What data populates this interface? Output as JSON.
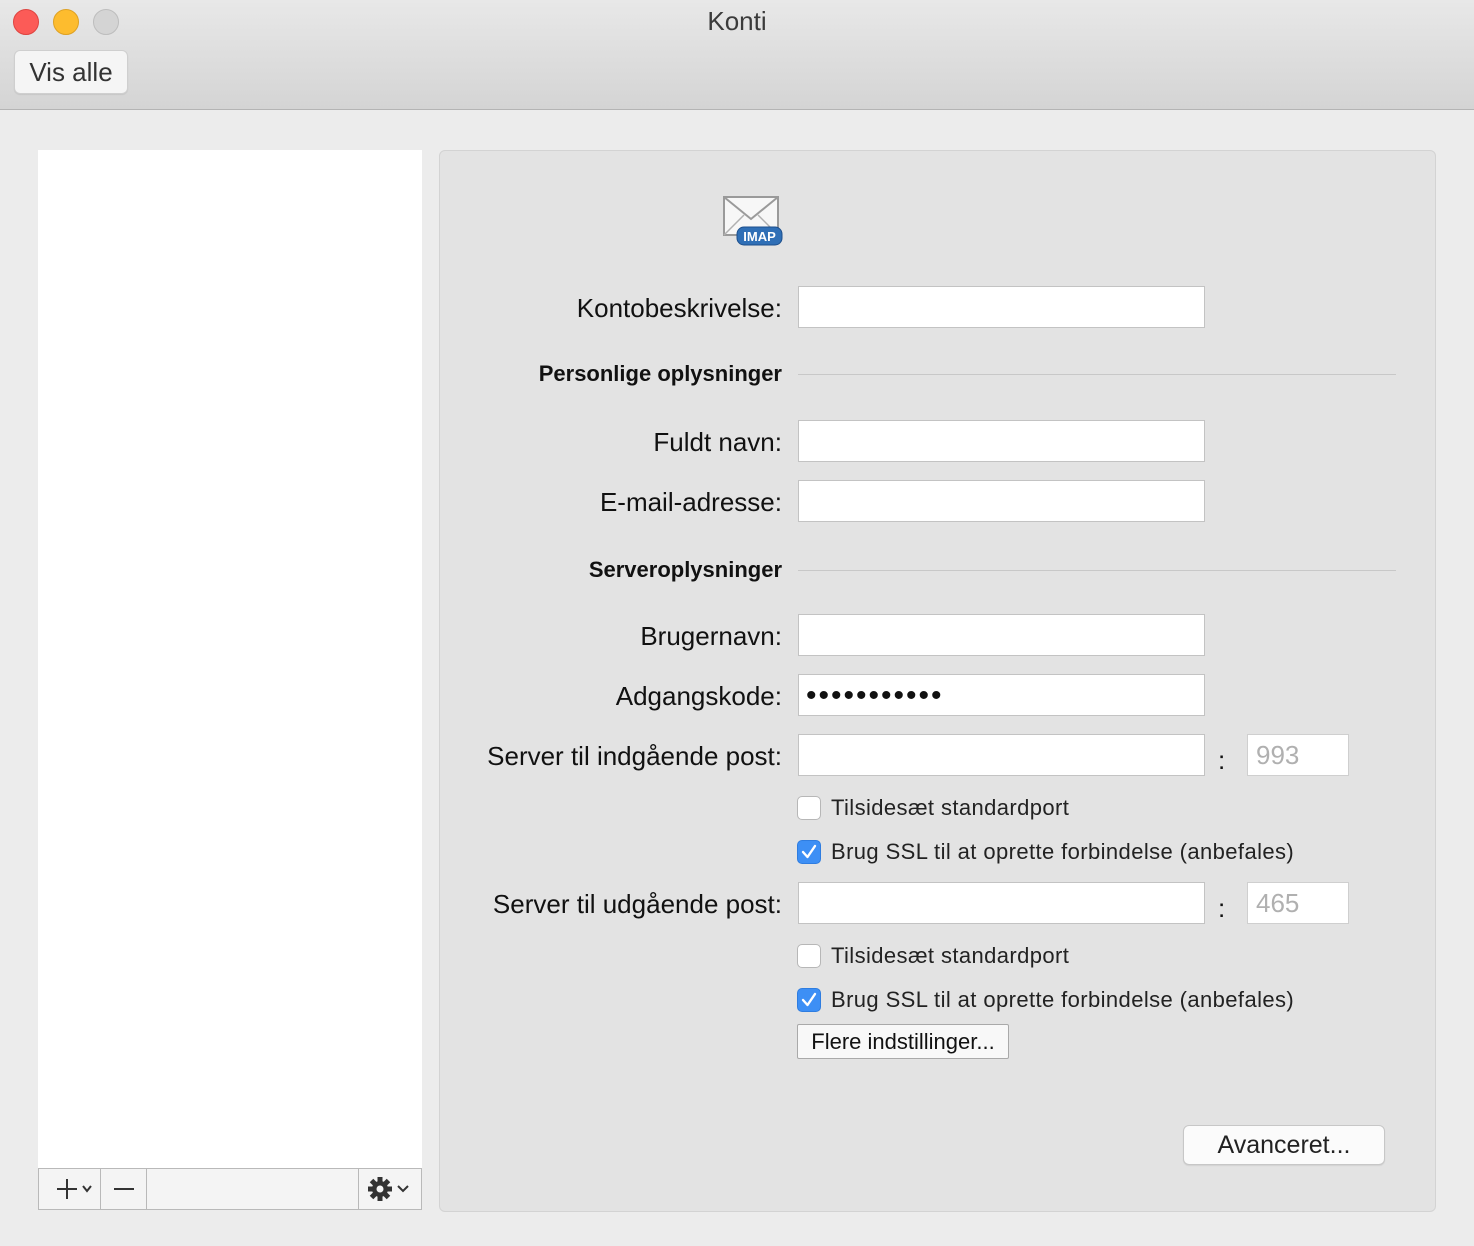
{
  "window": {
    "title": "Konti"
  },
  "toolbar": {
    "show_all_label": "Vis alle"
  },
  "account_list": {
    "items": []
  },
  "account": {
    "description_label": "Kontobeskrivelse:",
    "description_value": "",
    "personal_section": "Personlige oplysninger",
    "full_name_label": "Fuldt navn:",
    "full_name_value": "",
    "email_label": "E-mail-adresse:",
    "email_value": "",
    "server_section": "Serveroplysninger",
    "username_label": "Brugernavn:",
    "username_value": "",
    "password_label": "Adgangskode:",
    "password_mask": "•••••••••••",
    "incoming_label": "Server til indgående post:",
    "incoming_value": "",
    "incoming_port": "993",
    "incoming_override_port_label": "Tilsidesæt standardport",
    "incoming_override_port_checked": false,
    "incoming_ssl_label": "Brug SSL til at oprette forbindelse (anbefales)",
    "incoming_ssl_checked": true,
    "outgoing_label": "Server til udgående post:",
    "outgoing_value": "",
    "outgoing_port": "465",
    "outgoing_override_port_label": "Tilsidesæt standardport",
    "outgoing_override_port_checked": false,
    "outgoing_ssl_label": "Brug SSL til at oprette forbindelse (anbefales)",
    "outgoing_ssl_checked": true,
    "more_settings_label": "Flere indstillinger...",
    "advanced_label": "Avanceret...",
    "colon": ":",
    "imap_badge": "IMAP"
  },
  "colors": {
    "accent": "#3d8ff5",
    "close": "#fc5b57",
    "minimize": "#fdbc2e"
  }
}
